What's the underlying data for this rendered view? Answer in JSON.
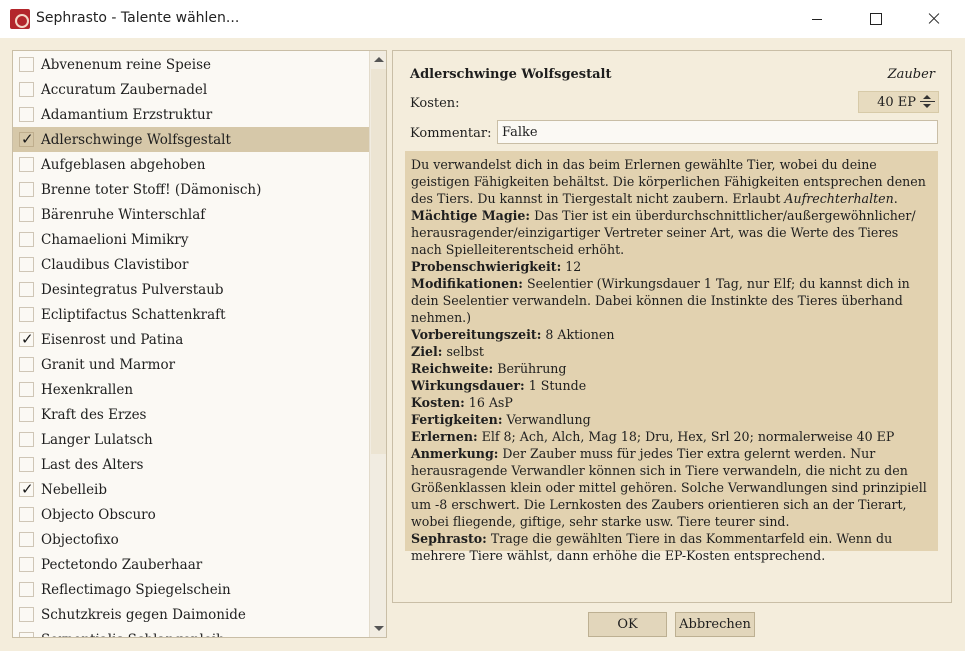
{
  "window": {
    "title": "Sephrasto - Talente wählen..."
  },
  "talents": [
    {
      "label": "Abvenenum reine Speise",
      "checked": false
    },
    {
      "label": "Accuratum Zaubernadel",
      "checked": false
    },
    {
      "label": "Adamantium Erzstruktur",
      "checked": false
    },
    {
      "label": "Adlerschwinge Wolfsgestalt",
      "checked": true,
      "selected": true
    },
    {
      "label": "Aufgeblasen abgehoben",
      "checked": false
    },
    {
      "label": "Brenne toter Stoff! (Dämonisch)",
      "checked": false
    },
    {
      "label": "Bärenruhe Winterschlaf",
      "checked": false
    },
    {
      "label": "Chamaelioni Mimikry",
      "checked": false
    },
    {
      "label": "Claudibus Clavistibor",
      "checked": false
    },
    {
      "label": "Desintegratus Pulverstaub",
      "checked": false
    },
    {
      "label": "Ecliptifactus Schattenkraft",
      "checked": false
    },
    {
      "label": "Eisenrost und Patina",
      "checked": true
    },
    {
      "label": "Granit und Marmor",
      "checked": false
    },
    {
      "label": "Hexenkrallen",
      "checked": false
    },
    {
      "label": "Kraft des Erzes",
      "checked": false
    },
    {
      "label": "Langer Lulatsch",
      "checked": false
    },
    {
      "label": "Last des Alters",
      "checked": false
    },
    {
      "label": "Nebelleib",
      "checked": true
    },
    {
      "label": "Objecto Obscuro",
      "checked": false
    },
    {
      "label": "Objectofixo",
      "checked": false
    },
    {
      "label": "Pectetondo Zauberhaar",
      "checked": false
    },
    {
      "label": "Reflectimago Spiegelschein",
      "checked": false
    },
    {
      "label": "Schutzkreis gegen Daimonide",
      "checked": false
    },
    {
      "label": "Serpentialis Schlangenleib",
      "checked": false
    }
  ],
  "detail": {
    "name": "Adlerschwinge Wolfsgestalt",
    "type": "Zauber",
    "kosten_label": "Kosten:",
    "kosten_value": "40 EP",
    "kommentar_label": "Kommentar:",
    "kommentar_value": "Falke",
    "intro": "Du verwandelst dich in das beim Erlernen gewählte Tier, wobei du deine geistigen Fähigkeiten behältst. Die körperlichen Fähigkeiten entsprechen denen des Tiers. Du kannst in Tiergestalt nicht zaubern. Erlaubt ",
    "intro_emph": "Aufrechterhalten",
    "intro_end": ".",
    "sections": [
      {
        "key": "Mächtige Magie:",
        "text": " Das Tier ist ein überdurchschnittlicher/außergewöhnlicher/ herausragender/einzigartiger Vertreter seiner Art, was die Werte des Tieres nach Spielleiterentscheid erhöht."
      },
      {
        "key": "Probenschwierigkeit:",
        "text": " 12"
      },
      {
        "key": "Modifikationen:",
        "text": " Seelentier (Wirkungsdauer 1 Tag, nur Elf; du kannst dich in dein Seelentier verwandeln. Dabei können die Instinkte des Tieres überhand nehmen.)"
      },
      {
        "key": "Vorbereitungszeit:",
        "text": " 8 Aktionen"
      },
      {
        "key": "Ziel:",
        "text": " selbst"
      },
      {
        "key": "Reichweite:",
        "text": " Berührung"
      },
      {
        "key": "Wirkungsdauer:",
        "text": " 1 Stunde"
      },
      {
        "key": "Kosten:",
        "text": " 16 AsP"
      },
      {
        "key": "Fertigkeiten:",
        "text": " Verwandlung"
      },
      {
        "key": "Erlernen:",
        "text": " Elf 8; Ach, Alch, Mag 18; Dru, Hex, Srl 20; normalerweise 40 EP"
      },
      {
        "key": "Anmerkung:",
        "text": " Der Zauber muss für jedes Tier extra gelernt werden. Nur herausragende Verwandler können sich in Tiere verwandeln, die nicht zu den Größenklassen klein oder mittel gehören. Solche Verwandlungen sind prinzipiell um -8 erschwert. Die Lernkosten des Zaubers orientieren sich an der Tierart, wobei fliegende, giftige, sehr starke usw. Tiere teurer sind."
      },
      {
        "key": "Sephrasto:",
        "text": " Trage die gewählten Tiere in das Kommentarfeld ein. Wenn du mehrere Tiere wählst, dann erhöhe die EP-Kosten entsprechend."
      }
    ]
  },
  "buttons": {
    "ok": "OK",
    "cancel": "Abbrechen"
  },
  "colors": {
    "background": "#f4eddc",
    "selection": "#d6c8a9",
    "description_bg": "#e2d2b0",
    "app_icon": "#b3262b"
  }
}
